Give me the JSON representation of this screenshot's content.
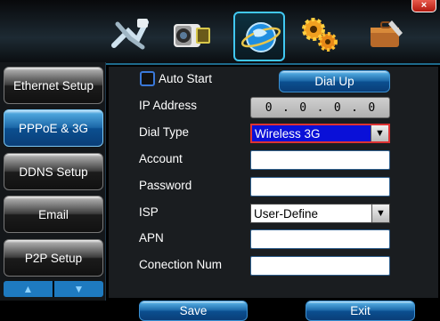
{
  "header": {
    "close_label": "×",
    "tabs": [
      {
        "icon": "network-cable-icon"
      },
      {
        "icon": "camera-icon"
      },
      {
        "icon": "network-globe-icon",
        "active": true
      },
      {
        "icon": "gears-icon"
      },
      {
        "icon": "toolbox-icon"
      }
    ]
  },
  "sidebar": {
    "items": [
      {
        "label": "Ethernet Setup"
      },
      {
        "label": "PPPoE & 3G",
        "active": true
      },
      {
        "label": "DDNS Setup"
      },
      {
        "label": "Email"
      },
      {
        "label": "P2P Setup"
      }
    ],
    "scroll_up": "▲",
    "scroll_down": "▼"
  },
  "form": {
    "auto_start_label": "Auto Start",
    "auto_start_checked": false,
    "dial_up_label": "Dial Up",
    "ip_label": "IP Address",
    "ip": [
      "0",
      ".",
      "0",
      ".",
      "0",
      ".",
      "0"
    ],
    "dial_type_label": "Dial Type",
    "dial_type_value": "Wireless 3G",
    "account_label": "Account",
    "account_value": "",
    "password_label": "Password",
    "password_value": "",
    "isp_label": "ISP",
    "isp_value": "User-Define",
    "apn_label": "APN",
    "apn_value": "",
    "connection_num_label": "Conection Num",
    "connection_num_value": ""
  },
  "footer": {
    "save_label": "Save",
    "exit_label": "Exit"
  },
  "colors": {
    "accent": "#1c68a8",
    "highlight": "#0a10d8"
  }
}
